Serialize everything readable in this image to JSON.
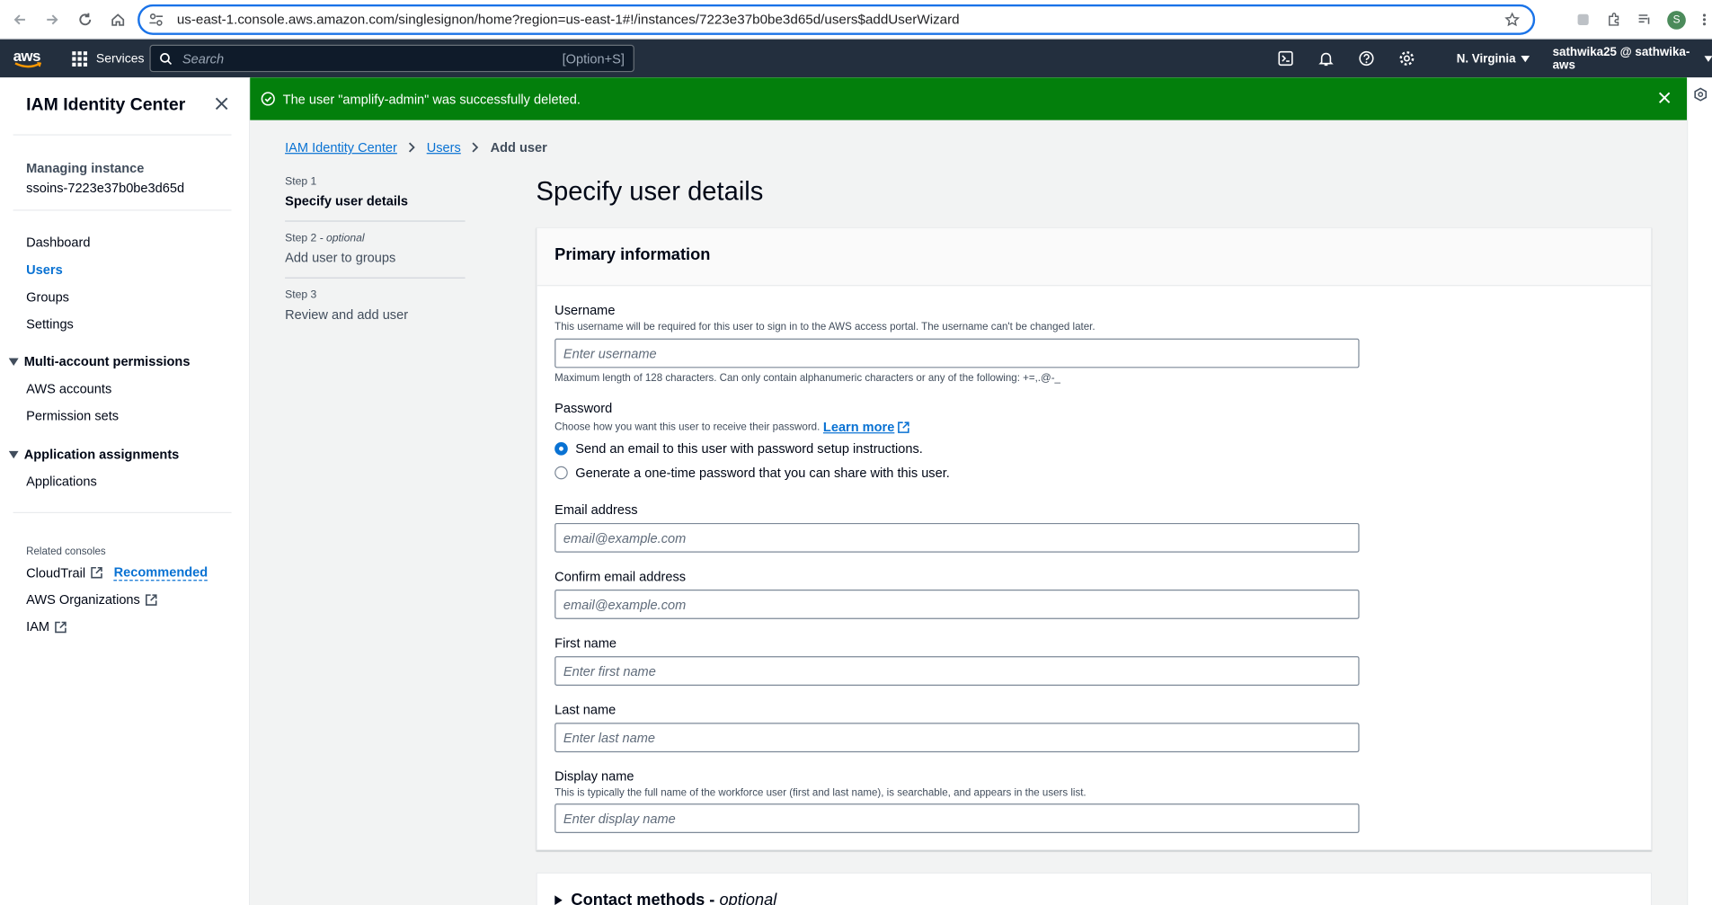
{
  "browser": {
    "url": "us-east-1.console.aws.amazon.com/singlesignon/home?region=us-east-1#!/instances/7223e37b0be3d65d/users$addUserWizard",
    "avatar_letter": "S"
  },
  "header": {
    "logo": "aws",
    "services": "Services",
    "search_placeholder": "Search",
    "search_shortcut": "[Option+S]",
    "region": "N. Virginia",
    "account": "sathwika25 @ sathwika-aws"
  },
  "sidebar": {
    "title": "IAM Identity Center",
    "instance_label": "Managing instance",
    "instance_id": "ssoins-7223e37b0be3d65d",
    "items": [
      "Dashboard",
      "Users",
      "Groups",
      "Settings"
    ],
    "group1": "Multi-account permissions",
    "group1_items": [
      "AWS accounts",
      "Permission sets"
    ],
    "group2": "Application assignments",
    "group2_items": [
      "Applications"
    ],
    "related_label": "Related consoles",
    "related": [
      "CloudTrail",
      "AWS Organizations",
      "IAM"
    ],
    "recommended": "Recommended"
  },
  "flash": {
    "message": "The user \"amplify-admin\" was successfully deleted."
  },
  "breadcrumb": [
    "IAM Identity Center",
    "Users",
    "Add user"
  ],
  "steps": [
    {
      "num": "Step 1",
      "optional": "",
      "title": "Specify user details"
    },
    {
      "num": "Step 2",
      "optional": " - optional",
      "title": "Add user to groups"
    },
    {
      "num": "Step 3",
      "optional": "",
      "title": "Review and add user"
    }
  ],
  "page_title": "Specify user details",
  "form": {
    "section_title": "Primary information",
    "username_label": "Username",
    "username_desc": "This username will be required for this user to sign in to the AWS access portal. The username can't be changed later.",
    "username_placeholder": "Enter username",
    "username_hint": "Maximum length of 128 characters. Can only contain alphanumeric characters or any of the following: +=,.@-_",
    "password_label": "Password",
    "password_desc": "Choose how you want this user to receive their password.",
    "learn_more": "Learn more",
    "radio1": "Send an email to this user with password setup instructions.",
    "radio2": "Generate a one-time password that you can share with this user.",
    "email_label": "Email address",
    "email_placeholder": "email@example.com",
    "confirm_email_label": "Confirm email address",
    "confirm_email_placeholder": "email@example.com",
    "first_label": "First name",
    "first_placeholder": "Enter first name",
    "last_label": "Last name",
    "last_placeholder": "Enter last name",
    "display_label": "Display name",
    "display_desc": "This is typically the full name of the workforce user (first and last name), is searchable, and appears in the users list.",
    "display_placeholder": "Enter display name"
  },
  "contact": {
    "title": "Contact methods -",
    "optional": "optional"
  }
}
